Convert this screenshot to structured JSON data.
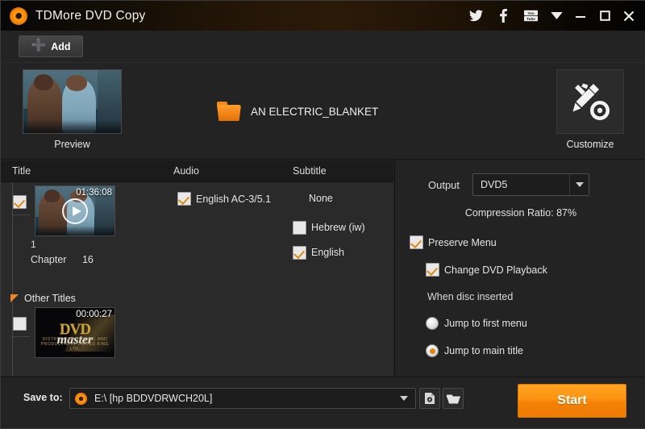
{
  "window": {
    "title": "TDMore DVD Copy",
    "app_icon": "disc-icon",
    "social": [
      {
        "name": "twitter-icon",
        "label": "Twitter"
      },
      {
        "name": "facebook-icon",
        "label": "Facebook"
      },
      {
        "name": "youtube-icon",
        "label": "YouTube"
      }
    ],
    "controls": [
      {
        "name": "menu-dropdown-icon",
        "label": "Menu"
      },
      {
        "name": "minimize-icon",
        "label": "Minimize"
      },
      {
        "name": "maximize-icon",
        "label": "Maximize"
      },
      {
        "name": "close-icon",
        "label": "Close"
      }
    ]
  },
  "toolbar": {
    "add_label": "Add",
    "add_icon": "plus-icon"
  },
  "top_panel": {
    "preview_label": "Preview",
    "disc_title": "AN ELECTRIC_BLANKET",
    "folder_icon": "folder-icon",
    "customize_label": "Customize",
    "customize_icon": "pencil-disc-icon",
    "arrow_icon": "chevron-right-icon"
  },
  "columns": {
    "title": "Title",
    "audio": "Audio",
    "subtitle": "Subtitle"
  },
  "titles": [
    {
      "index": "1",
      "duration": "01:36:08",
      "chapter_label": "Chapter",
      "chapter_count": "16",
      "checked": true,
      "play_icon": "play-icon"
    }
  ],
  "other_titles": {
    "label": "Other Titles",
    "expander_icon": "triangle-expander-icon",
    "items": [
      {
        "duration": "00:00:27",
        "checked": false,
        "thumb_line1": "DVD",
        "thumb_line2": "master",
        "thumb_line3": "DISTRIBUTED YOU ALL AND PRODUCTIONS UNITED KING LTD."
      }
    ]
  },
  "audio_tracks": [
    {
      "label": "English AC-3/5.1",
      "checked": true
    }
  ],
  "subtitle_tracks": {
    "none_label": "None",
    "items": [
      {
        "label": "Hebrew (iw)",
        "checked": false
      },
      {
        "label": "English",
        "checked": true
      }
    ]
  },
  "settings": {
    "output_label": "Output",
    "output_value": "DVD5",
    "output_options": [
      "DVD5"
    ],
    "compression_text": "Compression Ratio: 87%",
    "preserve_menu": {
      "label": "Preserve Menu",
      "checked": true
    },
    "change_playback": {
      "label": "Change DVD Playback",
      "checked": true
    },
    "when_inserted_label": "When disc inserted",
    "radios": [
      {
        "label": "Jump to first menu",
        "selected": false
      },
      {
        "label": "Jump to main title",
        "selected": true
      }
    ]
  },
  "footer": {
    "saveto_label": "Save to:",
    "saveto_value": "E:\\ [hp BDDVDRWCH20L]",
    "saveto_icon": "disc-icon",
    "iso_button_icon": "iso-file-icon",
    "folder_button_icon": "folder-open-icon",
    "start_label": "Start"
  },
  "colors": {
    "accent": "#f08a1a",
    "start_button": "#f98a08",
    "panel_bg": "#232323",
    "list_bg": "#2a2a2a",
    "header_bg": "#1b1b1b"
  }
}
